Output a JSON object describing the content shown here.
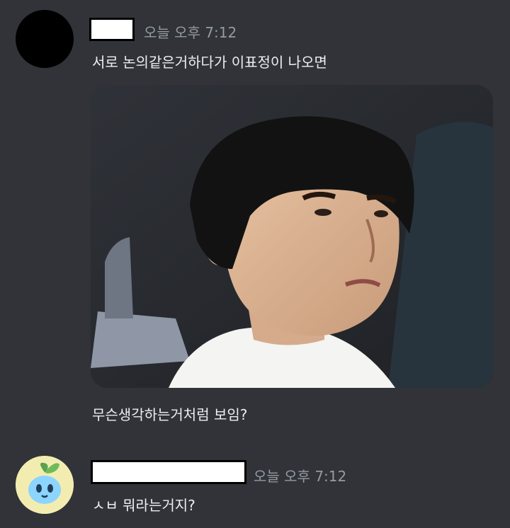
{
  "messages": [
    {
      "timestamp": "오늘 오후 7:12",
      "lines": [
        "서로 논의같은거하다가 이표정이 나오면",
        "무슨생각하는거처럼 보임?"
      ],
      "has_image_attachment": true
    },
    {
      "timestamp": "오늘 오후 7:12",
      "lines": [
        "ㅅㅂ 뭐라는거지?"
      ]
    }
  ],
  "colors": {
    "background": "#313338",
    "timestamp": "#949ba4",
    "text": "#eceff1",
    "redaction": "#ffffff"
  }
}
